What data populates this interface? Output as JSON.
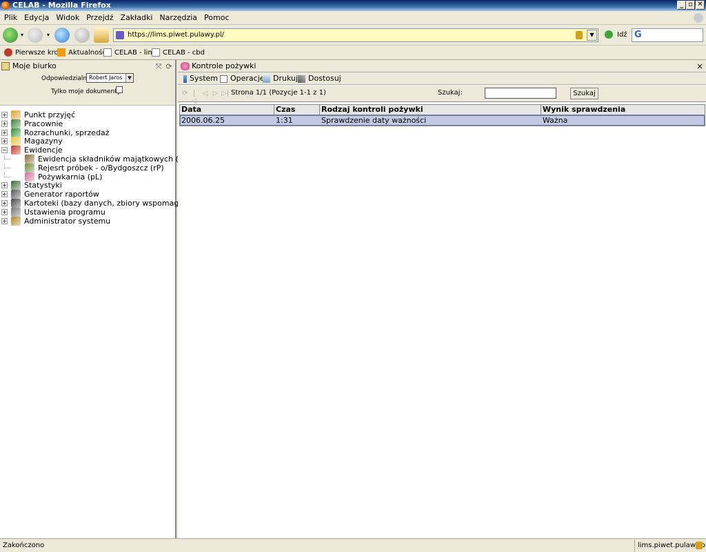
{
  "window": {
    "title": "CELAB - Mozilla Firefox"
  },
  "menu": [
    "Plik",
    "Edycja",
    "Widok",
    "Przejdź",
    "Zakładki",
    "Narzędzia",
    "Pomoc"
  ],
  "address": {
    "url": "https://lims.piwet.pulawy.pl/",
    "go_label": "Idź"
  },
  "bookmarks": [
    "Pierwsze kroki",
    "Aktualności",
    "CELAB - lims",
    "CELAB - cbd"
  ],
  "left": {
    "title": "Moje biurko",
    "responsible_label": "Odpowiedzialny:",
    "responsible_value": "Robert Jaros",
    "only_mine_label": "Tylko moje dokumenty:",
    "tree": [
      {
        "label": "Punkt przyjęć",
        "level": 0,
        "expander": "+"
      },
      {
        "label": "Pracownie",
        "level": 0,
        "expander": "+"
      },
      {
        "label": "Rozrachunki, sprzedaż",
        "level": 0,
        "expander": "+"
      },
      {
        "label": "Magazyny",
        "level": 0,
        "expander": "+"
      },
      {
        "label": "Ewidencje",
        "level": 0,
        "expander": "−"
      },
      {
        "label": "Ewidencja składników majątkowych (eL)",
        "level": 1,
        "expander": ""
      },
      {
        "label": "Rejesrt próbek - o/Bydgoszcz (rP)",
        "level": 1,
        "expander": ""
      },
      {
        "label": "Pożywkarnia (pL)",
        "level": 1,
        "expander": ""
      },
      {
        "label": "Statystyki",
        "level": 0,
        "expander": "+"
      },
      {
        "label": "Generator raportów",
        "level": 0,
        "expander": "+"
      },
      {
        "label": "Kartoteki (bazy danych, zbiory wspomagające)",
        "level": 0,
        "expander": "+"
      },
      {
        "label": "Ustawienia programu",
        "level": 0,
        "expander": "+"
      },
      {
        "label": "Administrator systemu",
        "level": 0,
        "expander": "+"
      }
    ]
  },
  "right": {
    "title": "Kontrole pożywki",
    "close": "×",
    "menu": [
      "System",
      "Operacje",
      "Drukuj",
      "Dostosuj"
    ],
    "page_info": "Strona 1/1 (Pozycje 1-1 z 1)",
    "search_label": "Szukaj:",
    "search_button": "Szukaj",
    "columns": [
      "Data",
      "Czas",
      "Rodzaj kontroli pożywki",
      "Wynik sprawdzenia"
    ],
    "rows": [
      [
        "2006.06.25",
        "1:31",
        "Sprawdzenie daty ważności",
        "Ważna"
      ]
    ]
  },
  "status": {
    "text": "Zakończono",
    "domain": "lims.piwet.pulawy.pl"
  }
}
